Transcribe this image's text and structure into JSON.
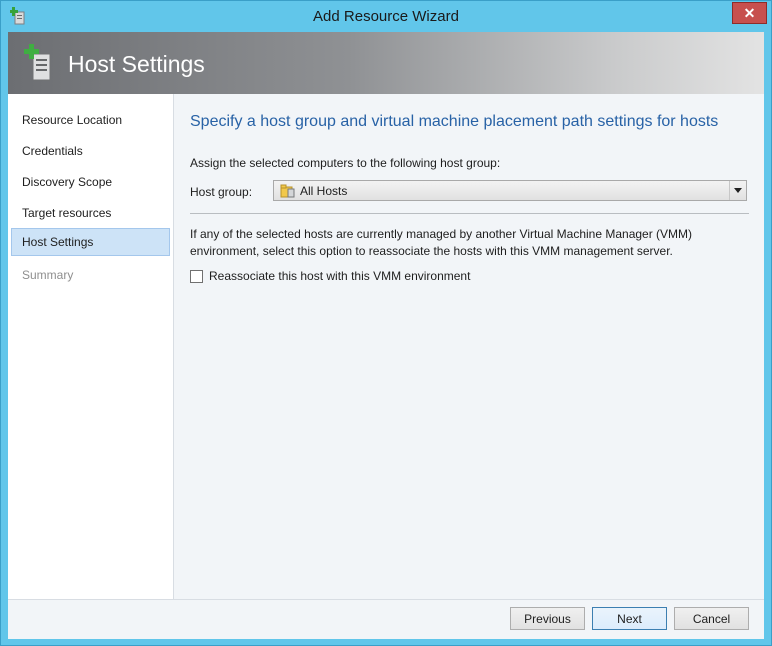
{
  "window": {
    "title": "Add Resource Wizard",
    "close_glyph": "✕"
  },
  "header": {
    "title": "Host Settings",
    "icon": "server-add-icon"
  },
  "nav": {
    "items": [
      {
        "label": "Resource Location",
        "state": "normal"
      },
      {
        "label": "Credentials",
        "state": "normal"
      },
      {
        "label": "Discovery Scope",
        "state": "normal"
      },
      {
        "label": "Target resources",
        "state": "normal"
      },
      {
        "label": "Host Settings",
        "state": "active"
      },
      {
        "label": "Summary",
        "state": "disabled"
      }
    ]
  },
  "main": {
    "heading": "Specify a host group and virtual machine placement path settings for hosts",
    "assign_label": "Assign the selected computers to the following host group:",
    "host_group_label": "Host group:",
    "host_group_value": "All Hosts",
    "host_group_icon": "host-group-folder-icon",
    "note": "If any of the selected hosts are currently managed by another Virtual Machine Manager (VMM) environment, select this option to reassociate the hosts with this VMM management server.",
    "reassociate_label": "Reassociate this host with this VMM environment",
    "reassociate_checked": false
  },
  "footer": {
    "previous_label": "Previous",
    "next_label": "Next",
    "cancel_label": "Cancel"
  },
  "colors": {
    "titlebar": "#61c6ea",
    "accent_heading": "#2862a6",
    "nav_selected": "#cde3f7",
    "close_button": "#c7504e"
  }
}
